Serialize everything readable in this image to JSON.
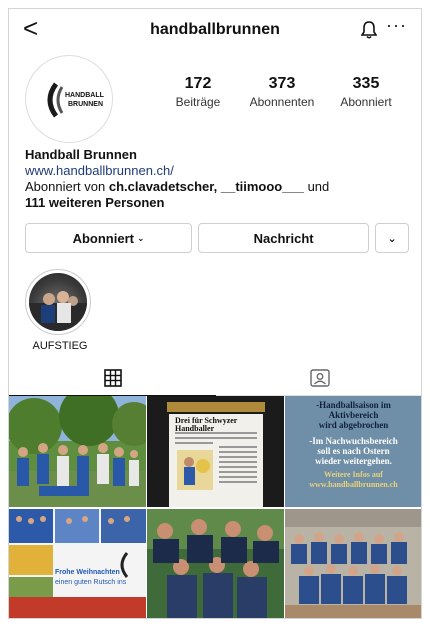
{
  "header": {
    "back_glyph": "<",
    "username": "handballbrunnen",
    "more_glyph": "···"
  },
  "profile": {
    "logo_text_1": "HANDBALL",
    "logo_text_2": "BRUNNEN",
    "stats": [
      {
        "value": "172",
        "label": "Beiträge"
      },
      {
        "value": "373",
        "label": "Abonnenten"
      },
      {
        "value": "335",
        "label": "Abonniert"
      }
    ],
    "name": "Handball Brunnen",
    "url": "www.handballbrunnen.ch/",
    "followed_prefix": "Abonniert von ",
    "followed_users": "ch.clavadetscher, __tiimooo___",
    "followed_and": " und",
    "followed_more": "111 weiteren Personen"
  },
  "buttons": {
    "following": "Abonniert",
    "message": "Nachricht"
  },
  "highlight": {
    "label": "AUFSTIEG"
  },
  "posts": {
    "post2_headline": "Drei für Schwyzer Handballer",
    "post3_lines": [
      "-Handballsaison im",
      "Aktivbereich",
      "wird abgebrochen",
      "-Im Nachwuchsbereich",
      "soll es nach Ostern",
      "wieder weitergehen.",
      "Weitere Infos auf",
      "www.handballbrunnen.ch"
    ],
    "post4_text": "Frohe Weihnachten",
    "post4_text2": "einen guten Rutsch ins"
  },
  "colors": {
    "link": "#1f3b7a",
    "post3_bg": "#6f8fa8",
    "post3_accent": "#e8d27a"
  }
}
